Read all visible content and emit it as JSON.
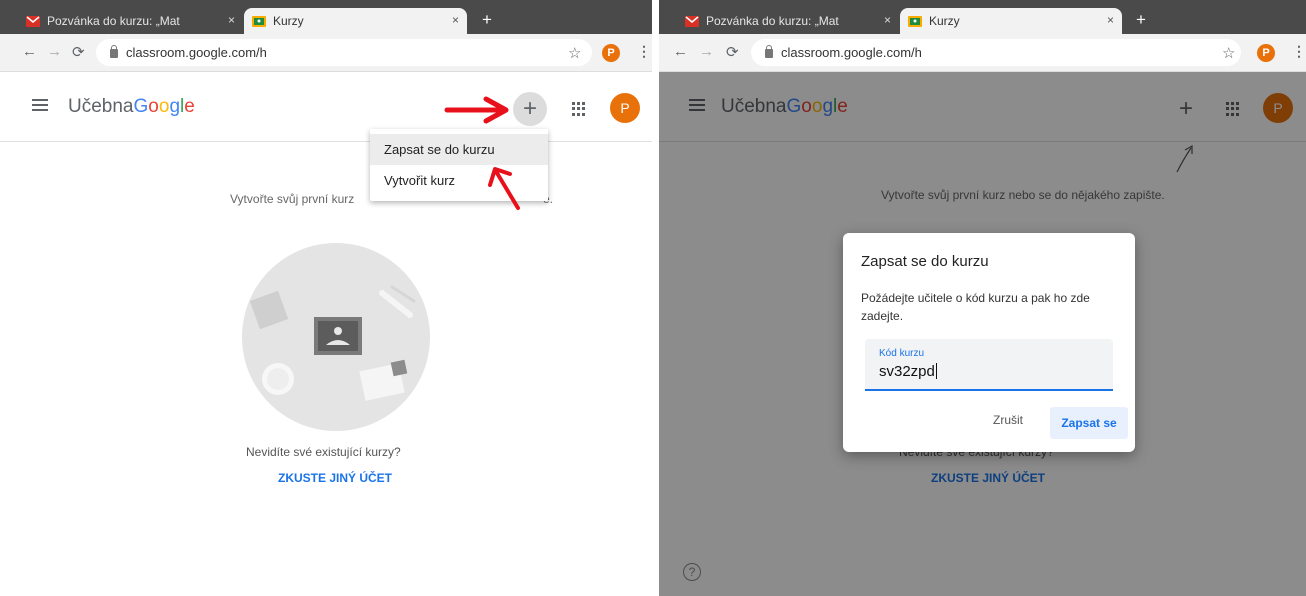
{
  "browser": {
    "tabs": [
      {
        "label": "Pozvánka do kurzu: „Mat",
        "icon": "gmail-icon"
      },
      {
        "label": "Kurzy",
        "icon": "classroom-icon"
      }
    ],
    "new_tab_label": "+",
    "tab_close_label": "×",
    "url": "classroom.google.com/h",
    "profile_letter": "P"
  },
  "app": {
    "brand_prefix": "Učebna",
    "brand_google": [
      "G",
      "o",
      "o",
      "g",
      "l",
      "e"
    ],
    "brand_colors": [
      "#4285f4",
      "#ea4335",
      "#fbbc05",
      "#4285f4",
      "#34a853",
      "#ea4335"
    ],
    "plus_label": "+",
    "avatar_letter": "P"
  },
  "menu": {
    "items": [
      "Zapsat se do kurzu",
      "Vytvořit kurz"
    ]
  },
  "empty_state": {
    "message": "Vytvořte svůj první kurz nebo se do nějakého zapište.",
    "left_visible_start": "Vytvořte svůj první kurz",
    "left_visible_end": "e.",
    "question": "Nevidíte své existující kurzy?",
    "link": "ZKUSTE JINÝ ÚČET"
  },
  "dialog": {
    "title": "Zapsat se do kurzu",
    "body": "Požádejte učitele o kód kurzu a pak ho zde zadejte.",
    "field_label": "Kód kurzu",
    "field_value": "sv32zpd",
    "cancel_label": "Zrušit",
    "join_label": "Zapsat se"
  },
  "help_label": "?",
  "colors": {
    "accent": "#1a73e8",
    "avatar": "#e8710a",
    "annotation_arrow": "#e8101a"
  }
}
